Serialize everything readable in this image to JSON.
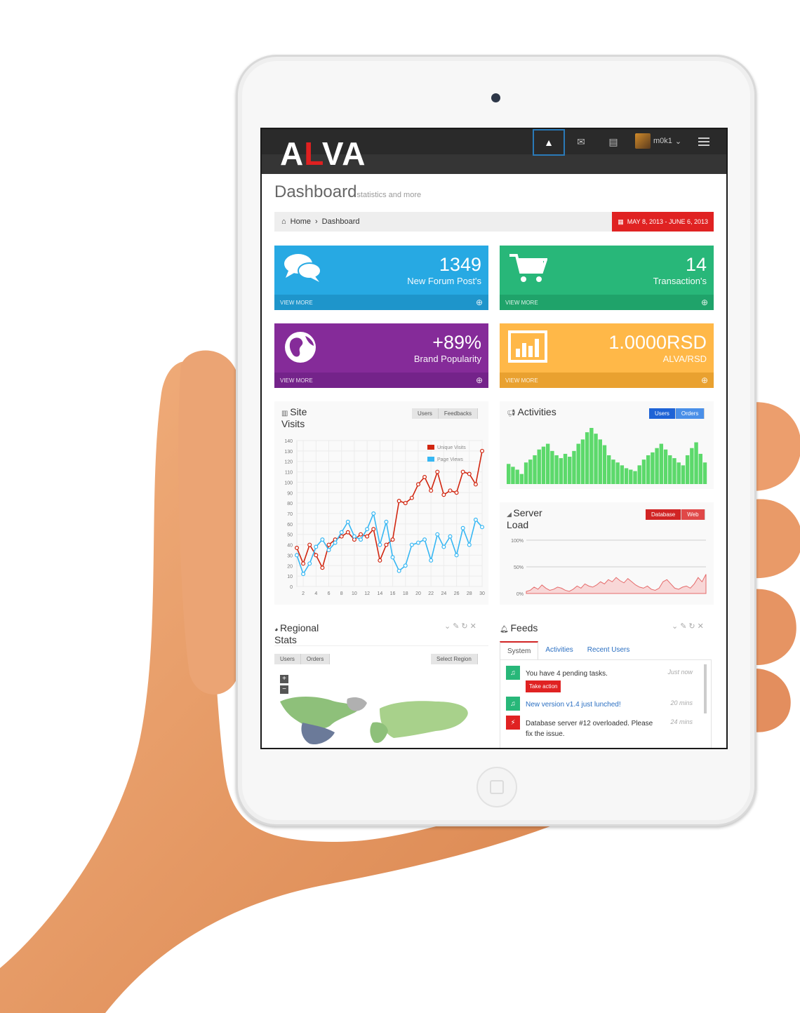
{
  "brand": {
    "logo_a": "A",
    "logo_l": "L",
    "logo_rest": "VA",
    "accent": "#e02020"
  },
  "topbar": {
    "username": "m0k1",
    "icons": [
      "warning-icon",
      "envelope-icon",
      "calendar-icon",
      "menu-icon"
    ]
  },
  "page": {
    "title": "Dashboard",
    "subtitle": "statistics and more"
  },
  "breadcrumb": {
    "home": "Home",
    "separator": "›",
    "current": "Dashboard",
    "daterange": "MAY 8, 2013 - JUNE 6, 2013"
  },
  "tiles": [
    {
      "number": "1349",
      "desc": "New Forum Post's",
      "more": "VIEW MORE",
      "color": "#27a9e3"
    },
    {
      "number": "14",
      "desc": "Transaction's",
      "more": "VIEW MORE",
      "color": "#28b779"
    },
    {
      "number": "+89%",
      "desc": "Brand Popularity",
      "more": "VIEW MORE",
      "color": "#852b99"
    },
    {
      "number": "1.0000RSD",
      "desc": "ALVA/RSD",
      "more": "VIEW MORE",
      "color": "#ffb848"
    }
  ],
  "site_visits": {
    "title_1": "Site",
    "title_2": "Visits",
    "btn_users": "Users",
    "btn_feedbacks": "Feedbacks"
  },
  "activities": {
    "title": "Activities",
    "btn_users": "Users",
    "btn_orders": "Orders"
  },
  "server_load": {
    "title_1": "Server",
    "title_2": "Load",
    "btn_database": "Database",
    "btn_web": "Web",
    "ticks": [
      "100%",
      "50%",
      "0%"
    ]
  },
  "regional": {
    "title_1": "Regional",
    "title_2": "Stats",
    "btn_users": "Users",
    "btn_orders": "Orders",
    "select_region": "Select Region",
    "zoom_in": "+",
    "zoom_out": "−"
  },
  "feeds": {
    "title": "Feeds",
    "tabs": [
      "System",
      "Activities",
      "Recent Users"
    ],
    "items": [
      {
        "text": "You have 4 pending tasks.",
        "action": "Take action",
        "time": "Just now",
        "color": "#28b779",
        "icon": "bell-icon"
      },
      {
        "text": "New version v1.4 just lunched!",
        "time": "20 mins",
        "color": "#28b779",
        "icon": "bell-icon"
      },
      {
        "text": "Database server #12 overloaded. Please fix the issue.",
        "time": "24 mins",
        "color": "#e02222",
        "icon": "bolt-icon"
      }
    ]
  },
  "chart_data": [
    {
      "type": "line",
      "x": [
        1,
        2,
        3,
        4,
        5,
        6,
        7,
        8,
        9,
        10,
        11,
        12,
        13,
        14,
        15,
        16,
        17,
        18,
        19,
        20,
        21,
        22,
        23,
        24,
        25,
        26,
        27,
        28,
        29,
        30
      ],
      "x_ticks": [
        "2",
        "4",
        "6",
        "8",
        "10",
        "12",
        "14",
        "16",
        "18",
        "20",
        "22",
        "24",
        "26",
        "28",
        "30"
      ],
      "y_ticks": [
        "140",
        "130",
        "120",
        "110",
        "100",
        "90",
        "80",
        "70",
        "60",
        "50",
        "40",
        "30",
        "20",
        "10",
        "0"
      ],
      "ylim": [
        0,
        140
      ],
      "series": [
        {
          "name": "Unique Visits",
          "color": "#d12610",
          "values": [
            37,
            22,
            40,
            30,
            18,
            40,
            45,
            48,
            52,
            45,
            50,
            48,
            55,
            25,
            40,
            45,
            82,
            80,
            85,
            98,
            105,
            92,
            110,
            88,
            92,
            90,
            110,
            108,
            98,
            130
          ]
        },
        {
          "name": "Page Views",
          "color": "#37b7f3",
          "values": [
            30,
            12,
            22,
            38,
            45,
            35,
            42,
            52,
            62,
            48,
            45,
            55,
            70,
            40,
            62,
            28,
            15,
            20,
            40,
            42,
            45,
            25,
            50,
            38,
            48,
            30,
            56,
            40,
            64,
            57
          ]
        }
      ]
    },
    {
      "type": "bar",
      "values": [
        28,
        24,
        20,
        14,
        30,
        34,
        40,
        48,
        52,
        56,
        46,
        40,
        36,
        42,
        38,
        46,
        56,
        62,
        72,
        78,
        70,
        62,
        54,
        40,
        34,
        30,
        26,
        22,
        20,
        18,
        26,
        34,
        40,
        44,
        50,
        56,
        48,
        40,
        36,
        30,
        26,
        40,
        50,
        58,
        42,
        30
      ],
      "color": "#5cd96b"
    },
    {
      "type": "area",
      "ticks": [
        "100%",
        "50%",
        "0%"
      ],
      "values": [
        4,
        6,
        12,
        8,
        16,
        10,
        6,
        8,
        12,
        10,
        6,
        4,
        8,
        14,
        10,
        18,
        14,
        12,
        16,
        22,
        18,
        26,
        22,
        30,
        24,
        20,
        28,
        22,
        16,
        12,
        10,
        14,
        8,
        6,
        10,
        22,
        26,
        18,
        10,
        8,
        12,
        14,
        10,
        18,
        30,
        22,
        36
      ],
      "color": "#e56b6b"
    }
  ]
}
